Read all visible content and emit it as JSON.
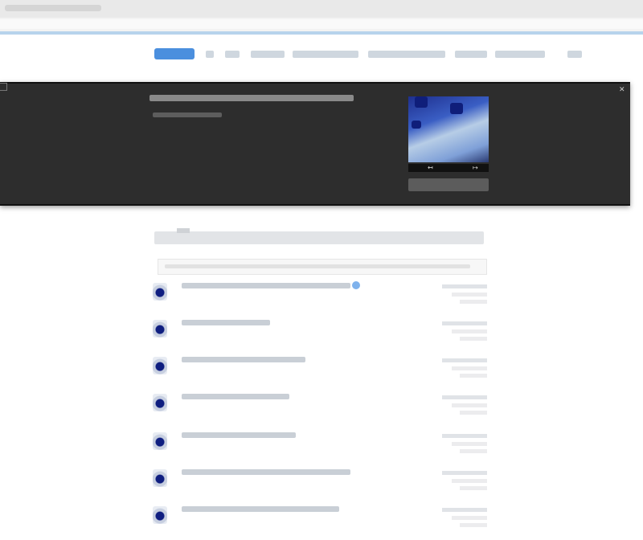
{
  "colors": {
    "nav_active": "#4b8fde",
    "panel_bg": "#2d2d2d",
    "accent_badge": "#7fb2ec",
    "chrome_line": "#b7d3ec"
  },
  "nav": {
    "items": [
      {
        "active": true
      },
      {
        "active": false
      },
      {
        "active": false
      },
      {
        "active": false
      },
      {
        "active": false
      },
      {
        "active": false
      },
      {
        "active": false
      },
      {
        "active": false
      },
      {
        "active": false
      }
    ]
  },
  "panel": {
    "thumbnail_icon": "image-thumbnail",
    "prev_icon": "arrow-left-icon",
    "next_icon": "arrow-right-icon",
    "close_icon": "close-icon"
  },
  "list": {
    "items": [
      {
        "icon": "file-icon",
        "badge": true
      },
      {
        "icon": "file-icon",
        "badge": false
      },
      {
        "icon": "file-icon",
        "badge": false
      },
      {
        "icon": "file-icon",
        "badge": false
      },
      {
        "icon": "file-icon",
        "badge": false
      },
      {
        "icon": "file-icon",
        "badge": false
      },
      {
        "icon": "file-icon",
        "badge": false
      }
    ]
  }
}
